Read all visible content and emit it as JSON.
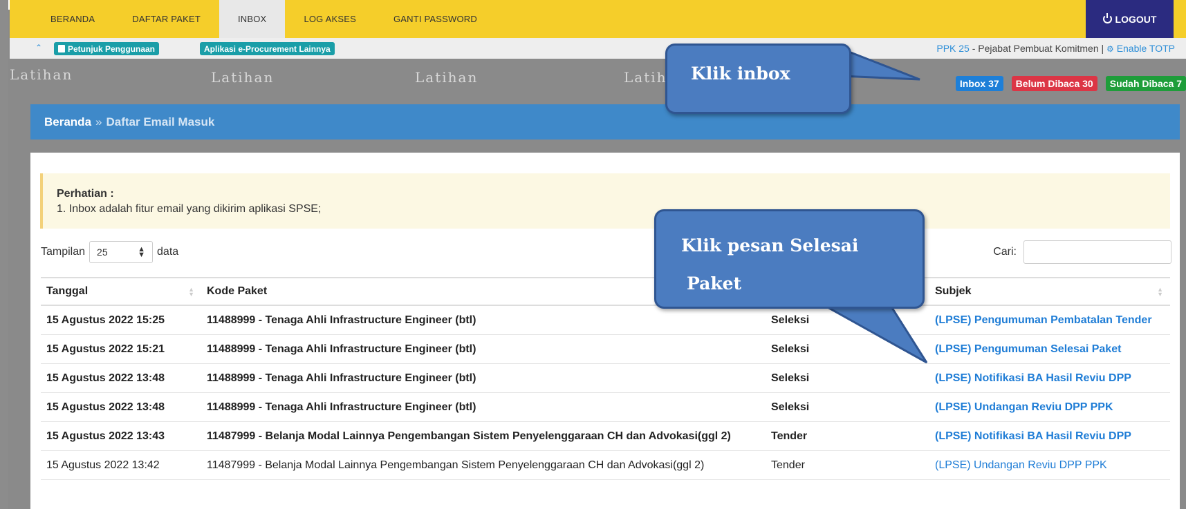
{
  "nav": {
    "items": [
      "BERANDA",
      "DAFTAR PAKET",
      "INBOX",
      "LOG AKSES",
      "GANTI PASSWORD"
    ],
    "active": "INBOX",
    "logout_label": "LOGOUT"
  },
  "subbar": {
    "guide_label": "Petunjuk Penggunaan",
    "eproc_label": "Aplikasi e-Procurement Lainnya",
    "user_role": "PPK 25",
    "user_desc": " - Pejabat Pembuat Komitmen | ",
    "totp_label": "Enable TOTP"
  },
  "badges": {
    "inbox": "Inbox 37",
    "unread": "Belum Dibaca 30",
    "read": "Sudah Dibaca 7"
  },
  "watermark": "Latihan",
  "breadcrumb": {
    "home": "Beranda",
    "separator": "»",
    "current": "Daftar Email Masuk"
  },
  "notice": {
    "title": "Perhatian :",
    "text": "1. Inbox adalah fitur email yang dikirim aplikasi SPSE;"
  },
  "table_controls": {
    "show_label": "Tampilan",
    "page_size": "25",
    "data_label": "data",
    "search_label": "Cari:"
  },
  "table": {
    "headers": [
      "Tanggal",
      "Kode Paket",
      "",
      "Subjek"
    ],
    "rows": [
      {
        "date": "15 Agustus 2022 15:25",
        "code": "11488999",
        "name": "Tenaga Ahli Infrastructure Engineer (btl)",
        "type": "Seleksi",
        "subject": "(LPSE) Pengumuman Pembatalan Tender",
        "unread": true
      },
      {
        "date": "15 Agustus 2022 15:21",
        "code": "11488999",
        "name": "Tenaga Ahli Infrastructure Engineer (btl)",
        "type": "Seleksi",
        "subject": "(LPSE) Pengumuman Selesai Paket",
        "unread": true
      },
      {
        "date": "15 Agustus 2022 13:48",
        "code": "11488999",
        "name": "Tenaga Ahli Infrastructure Engineer (btl)",
        "type": "Seleksi",
        "subject": "(LPSE) Notifikasi BA Hasil Reviu DPP",
        "unread": true
      },
      {
        "date": "15 Agustus 2022 13:48",
        "code": "11488999",
        "name": "Tenaga Ahli Infrastructure Engineer (btl)",
        "type": "Seleksi",
        "subject": "(LPSE) Undangan Reviu DPP PPK",
        "unread": true
      },
      {
        "date": "15 Agustus 2022 13:43",
        "code": "11487999",
        "name": "Belanja Modal Lainnya Pengembangan Sistem Penyelenggaraan CH dan Advokasi(ggl 2)",
        "type": "Tender",
        "subject": "(LPSE) Notifikasi BA Hasil Reviu DPP",
        "unread": true
      },
      {
        "date": "15 Agustus 2022 13:42",
        "code": "11487999",
        "name": "Belanja Modal Lainnya Pengembangan Sistem Penyelenggaraan CH dan Advokasi(ggl 2)",
        "type": "Tender",
        "subject": "(LPSE) Undangan Reviu DPP PPK",
        "unread": false
      }
    ]
  },
  "callouts": {
    "inbox": "Klik inbox",
    "selesai_line1": "Klik pesan Selesai",
    "selesai_line2": "Paket"
  }
}
